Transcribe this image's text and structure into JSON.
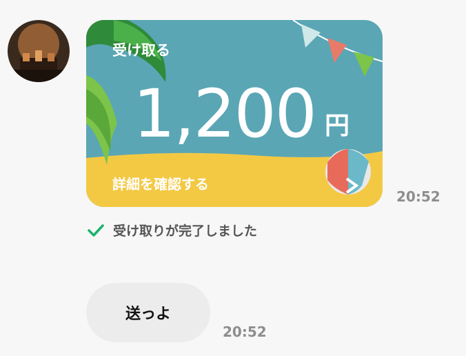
{
  "avatar": {
    "icon": "sender-avatar-image"
  },
  "card": {
    "receive_label": "受け取る",
    "amount": "1,200",
    "currency": "円",
    "details_link": "詳細を確認する",
    "colors": {
      "sky": "#5aa6b5",
      "sand": "#f3c944",
      "palm": "#3e9a3e"
    }
  },
  "card_time": "20:52",
  "status": {
    "text": "受け取りが完了しました",
    "icon": "checkmark-icon",
    "color": "#19b36b"
  },
  "message": {
    "text": "送っよ",
    "time": "20:52"
  }
}
